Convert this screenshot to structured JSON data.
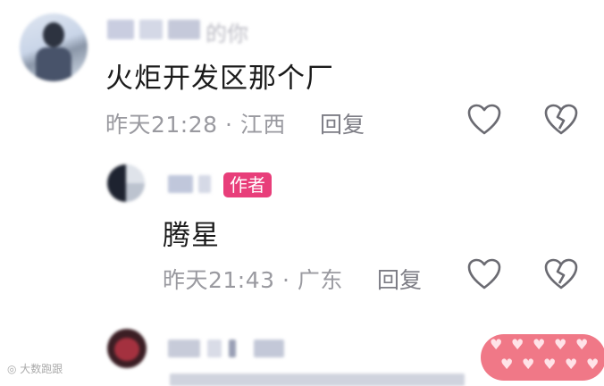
{
  "comments": [
    {
      "username_visible": "的你",
      "text": "火炬开发区那个厂",
      "time": "昨天21:28",
      "location": "江西",
      "reply_label": "回复"
    },
    {
      "badge": "作者",
      "text": "腾星",
      "time": "昨天21:43",
      "location": "广东",
      "reply_label": "回复"
    }
  ],
  "separator": "·",
  "watermark": "大数跑跟",
  "colors": {
    "badge": "#e83e7a",
    "meta": "#9a9aa0",
    "text": "#1b1b1b"
  },
  "icons": [
    "heart-outline-icon",
    "broken-heart-icon"
  ]
}
